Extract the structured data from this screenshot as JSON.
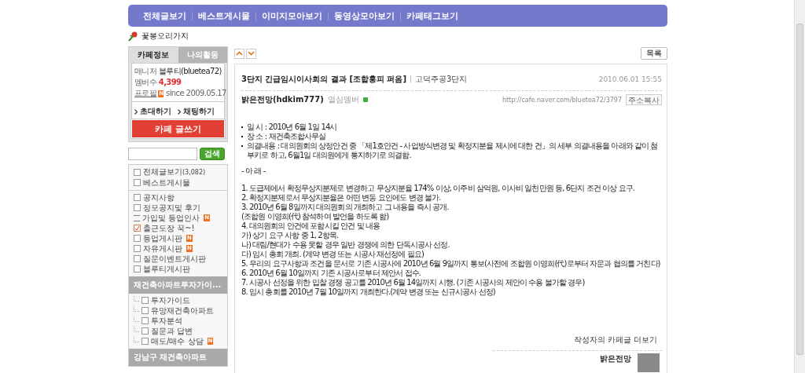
{
  "nav": [
    "전체글보기",
    "베스트게시물",
    "이미지모아보기",
    "동영상모아보기",
    "카페태그보기"
  ],
  "cafe_title": "꽃봉오리가지",
  "sidebar": {
    "tabs": [
      {
        "label": "카페정보",
        "selected": true
      },
      {
        "label": "나의활동",
        "selected": false
      }
    ],
    "info": {
      "manager_label": "매니저",
      "manager": "블루티(bluetea72)",
      "members_label": "멤버수",
      "members": "4,399",
      "profile_label": "프로필",
      "profile_badge": "N",
      "since": "since 2009.05.17"
    },
    "links": [
      "초대하기",
      "채팅하기"
    ],
    "write_button": "카페 글쓰기",
    "search_button": "검색",
    "top_items": [
      {
        "label": "전체글보기",
        "count": "(3,082)",
        "kind": "board"
      },
      {
        "label": "베스트게시물",
        "kind": "board"
      }
    ],
    "items": [
      {
        "label": "공지사항",
        "kind": "board"
      },
      {
        "label": "정모공지및 후기",
        "kind": "board"
      },
      {
        "label": "가입및 등업인사",
        "kind": "greeting",
        "badge": "N"
      },
      {
        "label": "출근도장 꾹~!",
        "kind": "attendance"
      },
      {
        "label": "등업게시판",
        "kind": "board",
        "badge": "N"
      },
      {
        "label": "자유게시판",
        "kind": "board",
        "badge": "N"
      },
      {
        "label": "질문이벤트게시판",
        "kind": "board"
      },
      {
        "label": "블루티게시판",
        "kind": "board"
      }
    ],
    "groups": [
      {
        "title": "재건축아파트투자가이...",
        "children": [
          {
            "label": "투자가이드"
          },
          {
            "label": "유망재건축아파트"
          },
          {
            "label": "투자분석"
          },
          {
            "label": "질문과 답변"
          },
          {
            "label": "매도/매수 상담",
            "badge": "N"
          }
        ]
      },
      {
        "title": "강남구 재건축아파트"
      }
    ]
  },
  "post": {
    "list_button": "목록",
    "title": "3단지 긴급임시이사회의 결과 [조합홍피 퍼옴]",
    "board": "고덕주공3단지",
    "date": "2010.06.01 15:55",
    "author": "밝은전망(hdkim777)",
    "rank": "열심멤버",
    "url": "http://cafe.naver.com/bluetea72/3797",
    "copy_button": "주소복사",
    "bullets": [
      "일 시 : 2010년 6월 1일 14시",
      "장 소 : 재건축조합사무실",
      "의결내용 : 대의원회의 상정안건 중 「제1호안건 - 사업방식변경 및 확정지분율 제시에 대한 건」의 세부 의결내용을 아래와 같이 첨부키로 하고, 6월1일 대의원에게 통지하기로 의결함."
    ],
    "heading": "- 아 래 -",
    "lines": [
      "1. 도급제에서 확정무상지분제로 변경하고 무상지분율 174% 이상, 이주비 삼억원, 이사비 일천만원 등, 6단지 조건 이상 요구.",
      "2. 확정지분제로서 무상지분율은 어떤 변동 요인에도 변경 불가.",
      "3. 2010년 6월 8일까지 대의원회의 개최하고 그 내용을 즉시 공개.",
      "(조합원 이영희(代) 참석하여 발언을 하도록 함)",
      "4. 대의원회의 안건에 포함시킬 안건 및 내용",
      "가) 상기 요구 사항 중 1, 2항목.",
      "나) 대림/현대가 수용 못할 경우 일반 경쟁에 의한 단독시공사 선정.",
      "다) 임시 총회 개최. (계약 변경 또는 시공사 재선정에 필요)",
      "5. 우리의 요구사항과 조건을 문서로 기존 시공사에 2010년 6월 9일까지 통보(사전에 조합원 이영희(代)로부터 자문과 협의를 거친다)",
      "6. 2010년 6월 10일까지 기존 시공사로부터 제안서 접수.",
      "7. 시공사 선정을 위한 입찰 경쟁 공고를 2010년 6월 14일까지 시행. (기존 시공사의 제안이 수용 불가할 경우)",
      "8. 임시 총회를 2010년 7월 10일까지 개최한다.(계약 변경 또는 신규시공사 선정)"
    ],
    "more_link": "작성자의 카페글 더보기",
    "writer": "밝은전망"
  }
}
